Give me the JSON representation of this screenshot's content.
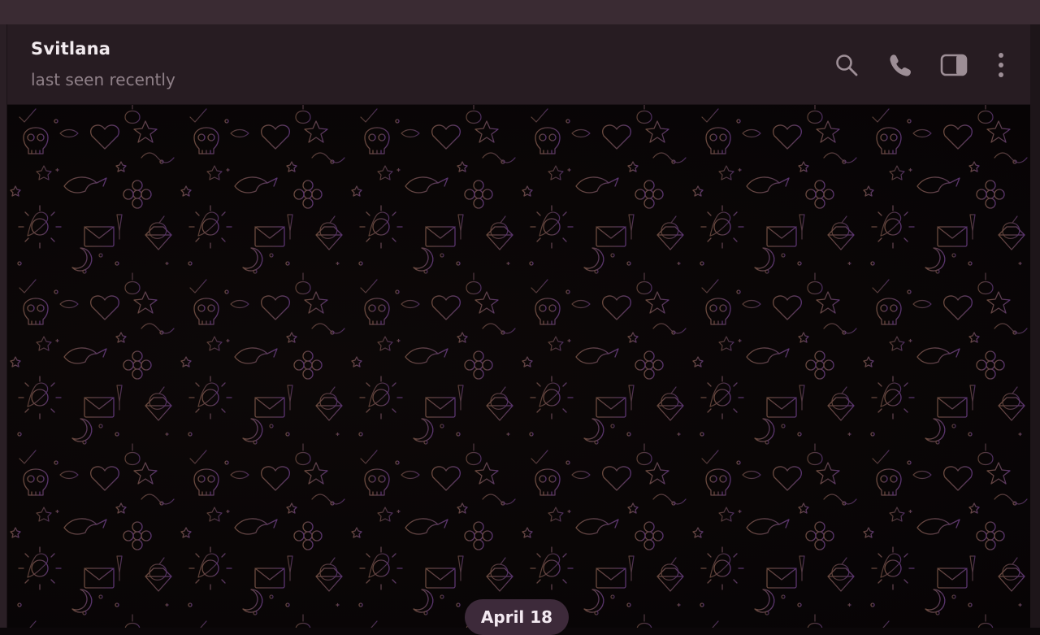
{
  "header": {
    "name": "Svitlana",
    "status": "last seen recently",
    "actions": [
      {
        "icon": "search-icon"
      },
      {
        "icon": "phone-icon"
      },
      {
        "icon": "sidebar-toggle-icon"
      },
      {
        "icon": "more-vertical-icon"
      }
    ]
  },
  "chat": {
    "date_separator": "April 18"
  },
  "colors": {
    "header_bg": "#271c22",
    "titlebar_bg": "#3a2b33",
    "chat_bg": "#070405",
    "icon_color": "#9d8e96",
    "pattern_warm": "#6b4a3e",
    "pattern_purple": "#5a3470",
    "date_pill_bg": "#3d2a3a"
  }
}
